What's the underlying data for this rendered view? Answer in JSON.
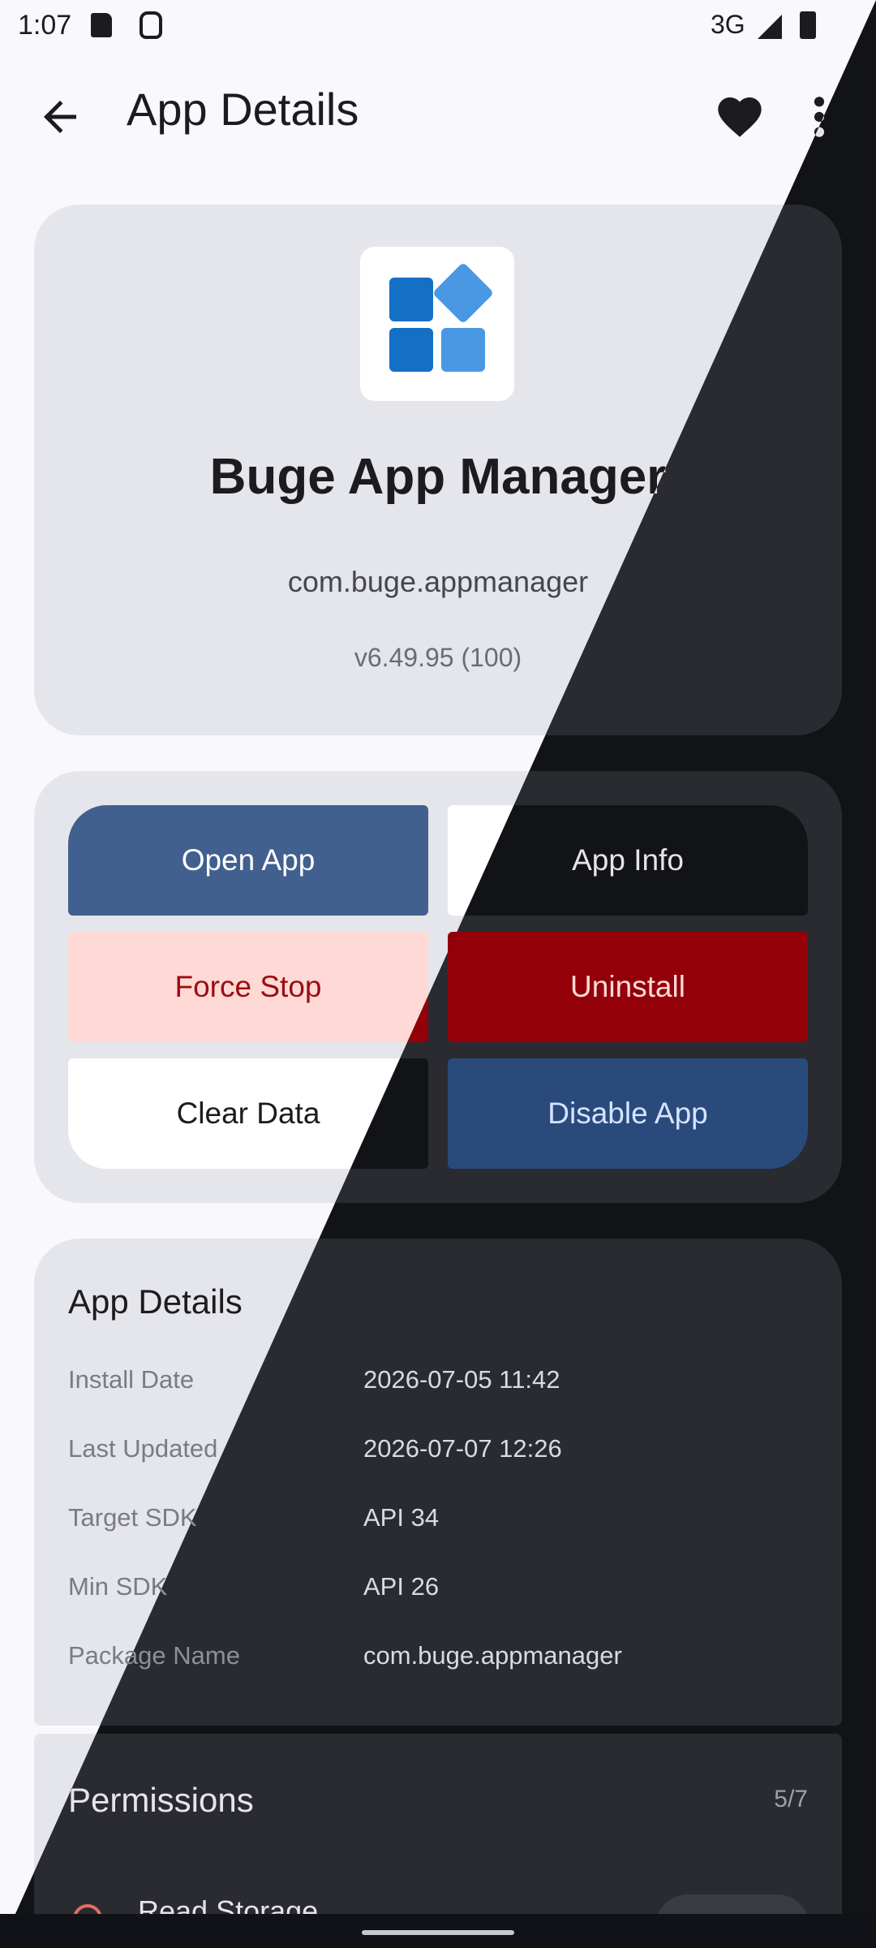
{
  "status_bar": {
    "time": "1:07",
    "network": "3G",
    "icons": [
      "sd-card-icon",
      "android-debug-icon",
      "signal-icon",
      "battery-icon"
    ]
  },
  "app_bar": {
    "title": "App Details",
    "icons": [
      "back-arrow-icon",
      "heart-icon",
      "more-vert-icon"
    ]
  },
  "app": {
    "name": "Buge App Manager",
    "package": "com.buge.appmanager",
    "version": "v6.49.95 (100)",
    "icon_colors": [
      "#1570c5",
      "#4a98e4"
    ]
  },
  "actions": {
    "open": "Open App",
    "info": "App Info",
    "force_stop": "Force Stop",
    "uninstall": "Uninstall",
    "clear_data": "Clear Data",
    "disable": "Disable App"
  },
  "details": {
    "title": "App Details",
    "rows": [
      {
        "label": "Install Date",
        "value": "2026-07-05 11:42"
      },
      {
        "label": "Last Updated",
        "value": "2026-07-07 12:26"
      },
      {
        "label": "Target SDK",
        "value": "API 34"
      },
      {
        "label": "Min SDK",
        "value": "API 26"
      },
      {
        "label": "Package Name",
        "value": "com.buge.appmanager"
      }
    ]
  },
  "permissions": {
    "title": "Permissions",
    "count": "5/7",
    "first_item": "Read Storage"
  },
  "colors": {
    "primary": "#41608f",
    "error": "#93000a",
    "error_container": "#ffd9d6",
    "light_bg": "#f8f8fd",
    "dark_bg": "#121317"
  }
}
